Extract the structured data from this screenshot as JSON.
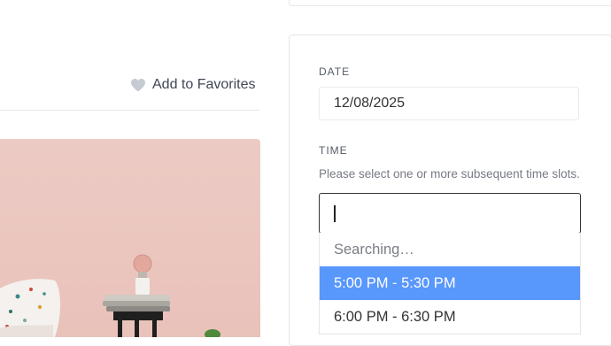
{
  "favorites": {
    "label": "Add to Favorites",
    "icon": "heart-icon"
  },
  "booking": {
    "date": {
      "label": "DATE",
      "value": "12/08/2025"
    },
    "time": {
      "label": "TIME",
      "help": "Please select one or more subsequent time slots.",
      "search_value": "",
      "searching_text": "Searching…",
      "options": [
        {
          "label": "5:00 PM - 5:30 PM",
          "highlighted": true
        },
        {
          "label": "6:00 PM - 6:30 PM",
          "highlighted": false
        }
      ]
    }
  },
  "colors": {
    "highlight": "#5897fb",
    "photo_wall": "#eccbc4"
  }
}
